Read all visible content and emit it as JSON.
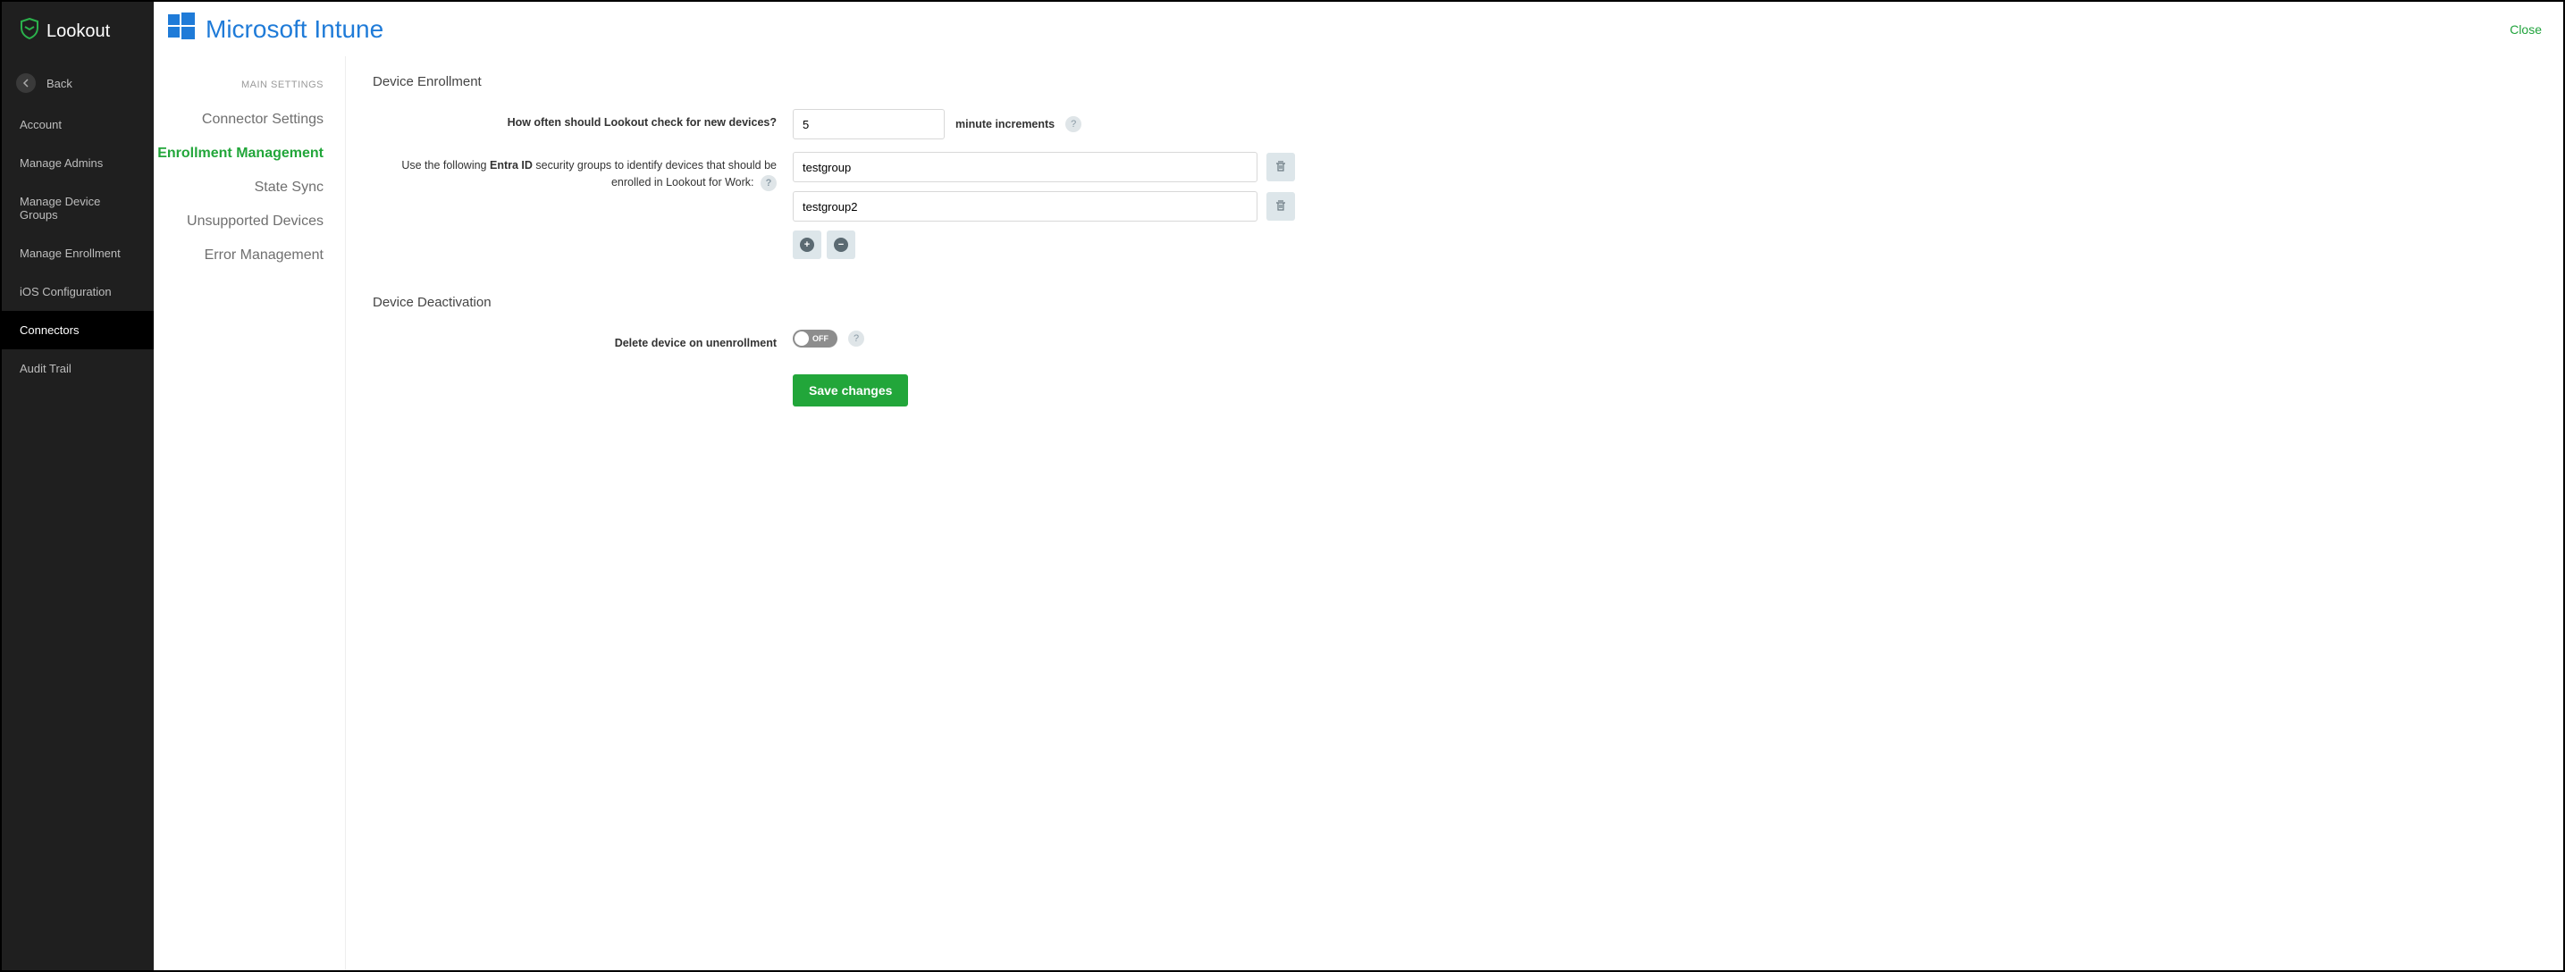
{
  "brand": {
    "name": "Lookout"
  },
  "sidebar": {
    "back_label": "Back",
    "items": [
      {
        "label": "Account",
        "active": false
      },
      {
        "label": "Manage Admins",
        "active": false
      },
      {
        "label": "Manage Device Groups",
        "active": false
      },
      {
        "label": "Manage Enrollment",
        "active": false
      },
      {
        "label": "iOS Configuration",
        "active": false
      },
      {
        "label": "Connectors",
        "active": true
      },
      {
        "label": "Audit Trail",
        "active": false
      }
    ]
  },
  "header": {
    "integration_name": "Microsoft Intune",
    "close_label": "Close"
  },
  "settings_nav": {
    "header": "MAIN SETTINGS",
    "items": [
      {
        "label": "Connector Settings",
        "active": false
      },
      {
        "label": "Enrollment Management",
        "active": true
      },
      {
        "label": "State Sync",
        "active": false
      },
      {
        "label": "Unsupported Devices",
        "active": false
      },
      {
        "label": "Error Management",
        "active": false
      }
    ]
  },
  "enrollment": {
    "section_title": "Device Enrollment",
    "check_label": "How often should Lookout check for new devices?",
    "check_value": "5",
    "check_unit": "minute increments",
    "groups_label_pre": "Use the following ",
    "groups_label_bold": "Entra ID",
    "groups_label_post": " security groups to identify devices that should be enrolled in Lookout for Work:",
    "groups": [
      {
        "name": "testgroup"
      },
      {
        "name": "testgroup2"
      }
    ]
  },
  "deactivation": {
    "section_title": "Device Deactivation",
    "delete_label": "Delete device on unenrollment",
    "toggle_value": "OFF"
  },
  "actions": {
    "save_label": "Save changes"
  }
}
